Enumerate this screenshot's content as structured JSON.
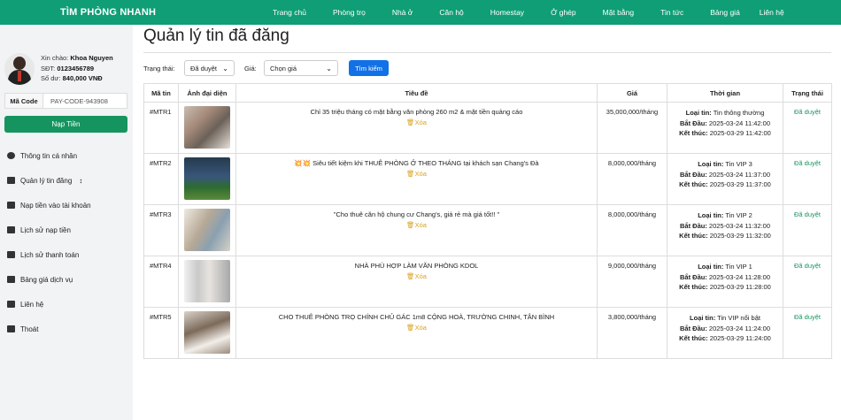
{
  "brand": "TÌM PHÒNG NHANH",
  "nav": [
    "Trang chủ",
    "Phòng trọ",
    "Nhà ở",
    "Căn hộ",
    "Homestay",
    "Ở ghép",
    "Mặt bằng",
    "Tin tức",
    "Bảng giá",
    "Liên hệ"
  ],
  "user": {
    "greet_label": "Xin chào:",
    "name": "Khoa Nguyen",
    "phone_label": "SĐT:",
    "phone": "0123456789",
    "balance_label": "Số dư:",
    "balance": "840,000 VNĐ"
  },
  "code": {
    "label": "Mã Code",
    "value": "PAY-CODE-943908"
  },
  "topup_label": "Nạp Tiền",
  "menu": [
    "Thông tin cá nhân",
    "Quản lý tin đăng",
    "Nạp tiền vào tài khoản",
    "Lịch sử nạp tiền",
    "Lịch sử thanh toán",
    "Bảng giá dịch vụ",
    "Liên hệ",
    "Thoát"
  ],
  "page_title": "Quản lý tin đã đăng",
  "filters": {
    "status_label": "Trạng thái:",
    "status_value": "Đã duyệt",
    "price_label": "Giá:",
    "price_value": "Chọn giá",
    "search_label": "Tìm kiếm"
  },
  "columns": [
    "Mã tin",
    "Ảnh đại diện",
    "Tiêu đề",
    "Giá",
    "Thời gian",
    "Trạng thái"
  ],
  "labels": {
    "delete": "Xóa",
    "type": "Loại tin:",
    "start": "Bắt Đầu:",
    "end": "Kết thúc:"
  },
  "rows": [
    {
      "id": "#MTR1",
      "title": "Chỉ 35 triệu tháng có mặt bằng văn phòng 260 m2 & mặt tiền quảng cáo",
      "price": "35,000,000/tháng",
      "type": "Tin thông thường",
      "start": "2025-03-24 11:42:00",
      "end": "2025-03-29 11:42:00",
      "status": "Đã duyệt"
    },
    {
      "id": "#MTR2",
      "title": "💥💥 Siêu tiết kiệm khi THUÊ PHÒNG Ở THEO THÁNG tại khách sạn Chang's Đà",
      "price": "8,000,000/tháng",
      "type": "Tin VIP 3",
      "start": "2025-03-24 11:37:00",
      "end": "2025-03-29 11:37:00",
      "status": "Đã duyệt"
    },
    {
      "id": "#MTR3",
      "title": "\"Cho thuê căn hộ chung cư Chang's, giá rẻ mà giá tốt!! \"",
      "price": "8,000,000/tháng",
      "type": "Tin VIP 2",
      "start": "2025-03-24 11:32:00",
      "end": "2025-03-29 11:32:00",
      "status": "Đã duyệt"
    },
    {
      "id": "#MTR4",
      "title": "NHÀ PHÙ HỢP LÀM VĂN PHÒNG KDOL",
      "price": "9,000,000/tháng",
      "type": "Tin VIP 1",
      "start": "2025-03-24 11:28:00",
      "end": "2025-03-29 11:28:00",
      "status": "Đã duyệt"
    },
    {
      "id": "#MTR5",
      "title": "CHO THUÊ PHÒNG TRỌ CHÍNH CHỦ GÁC 1m8 CỘNG HOÀ, TRƯỜNG CHINH, TÂN BÌNH",
      "price": "3,800,000/tháng",
      "type": "Tin VIP nổi bật",
      "start": "2025-03-24 11:24:00",
      "end": "2025-03-29 11:24:00",
      "status": "Đã duyệt"
    }
  ]
}
